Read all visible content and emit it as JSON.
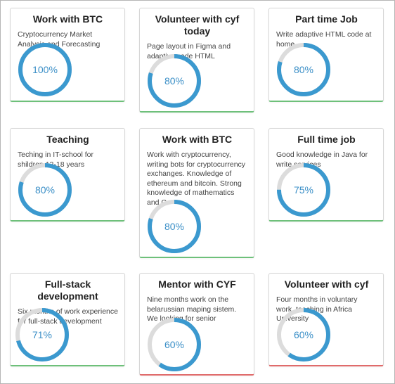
{
  "colors": {
    "ring_fill": "#3b99cf",
    "ring_track": "#dcdcdc",
    "percent_text": "#3b8fc7",
    "accent_green": "#6ec07a",
    "accent_red": "#e06b6b"
  },
  "cards": [
    {
      "title": "Work with BTC",
      "description": "Cryptocurrency Market Analysis and Forecasting",
      "percent_label": "100%",
      "progress": 1.0,
      "accent": "green"
    },
    {
      "title": "Volunteer with cyf today",
      "description": "Page layout in Figma and adaptive code HTML",
      "percent_label": "80%",
      "progress": 0.8,
      "accent": "green"
    },
    {
      "title": "Part time Job",
      "description": "Write adaptive HTML code at home",
      "percent_label": "80%",
      "progress": 0.8,
      "accent": "green"
    },
    {
      "title": "Teaching",
      "description": "Teching in IT-school for shildren 12-18 years",
      "percent_label": "80%",
      "progress": 0.8,
      "accent": "green"
    },
    {
      "title": "Work with BTC",
      "description": "Work with cryptocurrency, writing bots for cryptocurrency exchanges. Knowledge of ethereum and bitcoin. Strong knowledge of mathematics and C",
      "percent_label": "80%",
      "progress": 0.8,
      "accent": "green"
    },
    {
      "title": "Full time job",
      "description": "Good knowledge in Java for write services",
      "percent_label": "75%",
      "progress": 0.75,
      "accent": "green"
    },
    {
      "title": "Full-stack development",
      "description": "Six months of work experience for full-stack development",
      "percent_label": "71%",
      "progress": 0.71,
      "accent": "green"
    },
    {
      "title": "Mentor with CYF",
      "description": "Nine months work on the belarussian maping sistem. We looking for senior",
      "percent_label": "60%",
      "progress": 0.6,
      "accent": "red"
    },
    {
      "title": "Volunteer with cyf",
      "description": "Four months in voluntary work, teaching in Africa University",
      "percent_label": "60%",
      "progress": 0.6,
      "accent": "red"
    }
  ]
}
